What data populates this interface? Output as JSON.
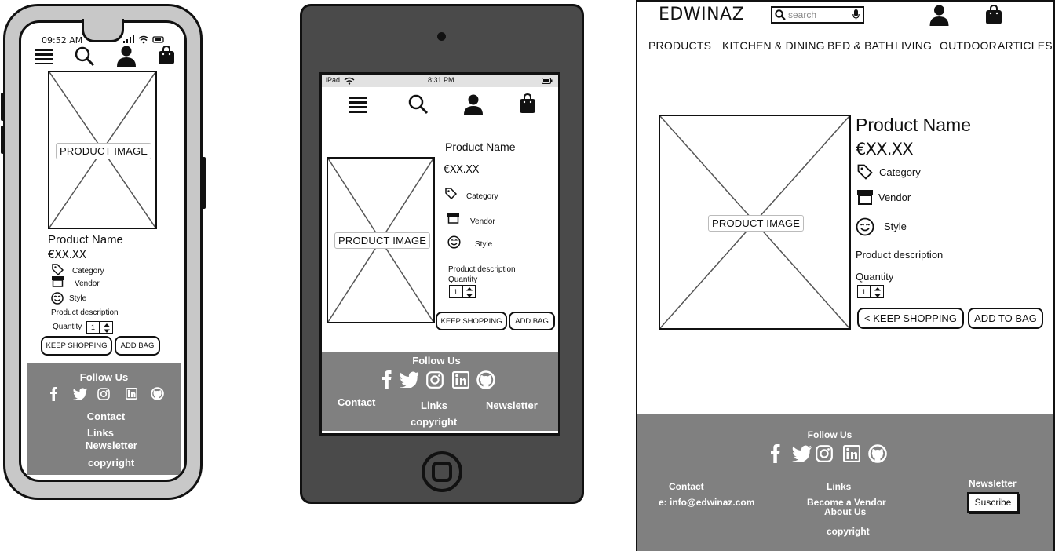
{
  "phone": {
    "status": {
      "time": "09:52 AM"
    },
    "header_icons": [
      "menu-icon",
      "search-icon",
      "user-icon",
      "bag-icon"
    ],
    "image_label": "PRODUCT IMAGE",
    "product": {
      "name": "Product Name",
      "price": "€XX.XX",
      "category": "Category",
      "vendor": "Vendor",
      "style": "Style",
      "description": "Product description",
      "quantity_label": "Quantity",
      "quantity_value": "1"
    },
    "buttons": {
      "keep_shopping": "KEEP SHOPPING",
      "add_bag": "ADD BAG"
    },
    "footer": {
      "follow_us": "Follow Us",
      "contact": "Contact",
      "links": "Links",
      "newsletter": "Newsletter",
      "copyright": "copyright"
    }
  },
  "tablet": {
    "status": {
      "device": "iPad",
      "time": "8:31 PM"
    },
    "image_label": "PRODUCT IMAGE",
    "product": {
      "name": "Product Name",
      "price": "€XX.XX",
      "category": "Category",
      "vendor": "Vendor",
      "style": "Style",
      "description": "Product description",
      "quantity_label": "Quantity",
      "quantity_value": "1"
    },
    "buttons": {
      "keep_shopping": "KEEP SHOPPING",
      "add_bag": "ADD BAG"
    },
    "footer": {
      "follow_us": "Follow Us",
      "contact": "Contact",
      "links": "Links",
      "newsletter": "Newsletter",
      "copyright": "copyright"
    }
  },
  "desktop": {
    "logo": "EDWINAZ",
    "search_placeholder": "search",
    "nav": [
      "PRODUCTS",
      "KITCHEN & DINING",
      "BED & BATH",
      "LIVING",
      "OUTDOOR",
      "ARTICLES"
    ],
    "image_label": "PRODUCT IMAGE",
    "product": {
      "name": "Product Name",
      "price": "€XX.XX",
      "category": "Category",
      "vendor": "Vendor",
      "style": "Style",
      "description": "Product description",
      "quantity_label": "Quantity",
      "quantity_value": "1"
    },
    "buttons": {
      "keep_shopping": "< KEEP SHOPPING",
      "add_to_bag": "ADD TO BAG"
    },
    "footer": {
      "follow_us": "Follow Us",
      "contact_heading": "Contact",
      "email": "e: info@edwinaz.com",
      "links_heading": "Links",
      "become_vendor": "Become a Vendor",
      "about_us": "About Us",
      "newsletter_heading": "Newsletter",
      "subscribe": "Suscribe",
      "copyright": "copyright"
    }
  },
  "social_icons": [
    "facebook-icon",
    "twitter-icon",
    "instagram-icon",
    "linkedin-icon",
    "github-icon"
  ],
  "colors": {
    "footer_grey": "#808080",
    "tablet_body": "#4a4a4a",
    "phone_body": "#c8c8c8",
    "status_bar": "#e2e2e2",
    "ink": "#111111"
  }
}
